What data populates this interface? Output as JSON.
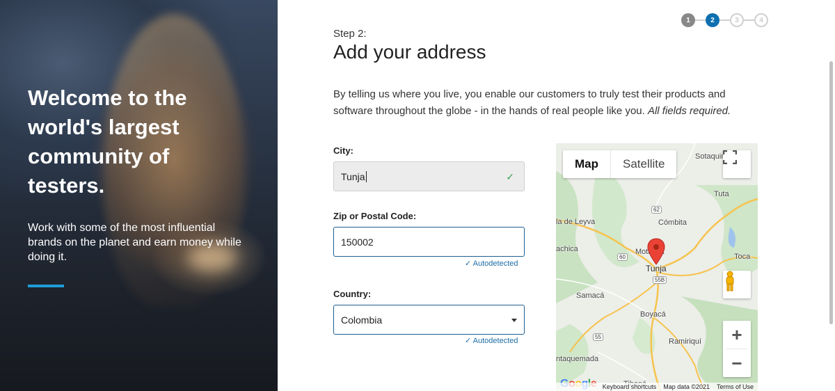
{
  "hero": {
    "title": "Welcome to the world's largest community of testers.",
    "subtitle": "Work with some of the most influential brands on the planet and earn money while doing it.",
    "accent_color": "#1e9bd7"
  },
  "stepper": {
    "steps": [
      "1",
      "2",
      "3",
      "4"
    ],
    "current": 2
  },
  "form": {
    "step_label": "Step 2:",
    "title": "Add your address",
    "intro": "By telling us where you live, you enable our customers to truly test their products and software throughout the globe - in the hands of real people like you.",
    "intro_em": "All fields required.",
    "city_label": "City:",
    "city_value": "Tunja",
    "zip_label": "Zip or Postal Code:",
    "zip_value": "150002",
    "zip_autodetected": "Autodetected",
    "country_label": "Country:",
    "country_value": "Colombia",
    "country_autodetected": "Autodetected"
  },
  "map": {
    "tab_map": "Map",
    "tab_satellite": "Satellite",
    "zoom_in": "+",
    "zoom_out": "−",
    "towns": {
      "sotaquira": "Sotaquirá",
      "tuta": "Tuta",
      "leyva": "la de Leyva",
      "combita": "Cómbita",
      "chiquinquira": "achica",
      "motavita": "Motavita",
      "tunja": "Tunja",
      "toca": "Toca",
      "samaca": "Samacá",
      "boyaca": "Boyacá",
      "ramiriqui": "Ramiriquí",
      "ventaquemada": "ntaquemada",
      "tibana": "Tibaná"
    },
    "roads": {
      "r62": "62",
      "r60": "60",
      "r55b": "55B",
      "r55": "55"
    },
    "footer": {
      "logo": "Google",
      "shortcuts": "Keyboard shortcuts",
      "data": "Map data ©2021",
      "terms": "Terms of Use"
    }
  }
}
